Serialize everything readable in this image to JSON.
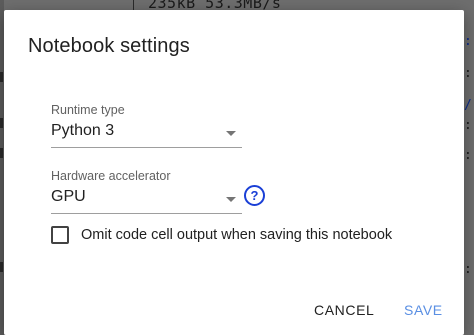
{
  "background": {
    "top_output": "235kB 53.3MB/s"
  },
  "dialog": {
    "title": "Notebook settings",
    "runtime_type": {
      "label": "Runtime type",
      "value": "Python 3"
    },
    "hardware_accelerator": {
      "label": "Hardware accelerator",
      "value": "GPU"
    },
    "help_icon_glyph": "?",
    "omit_output": {
      "label": "Omit code cell output when saving this notebook",
      "checked": false
    },
    "buttons": {
      "cancel": "CANCEL",
      "save": "SAVE"
    }
  },
  "colors": {
    "accent": "#1a3fd6",
    "save_text": "#5a8fe3",
    "backdrop": "#6e6e6e"
  }
}
